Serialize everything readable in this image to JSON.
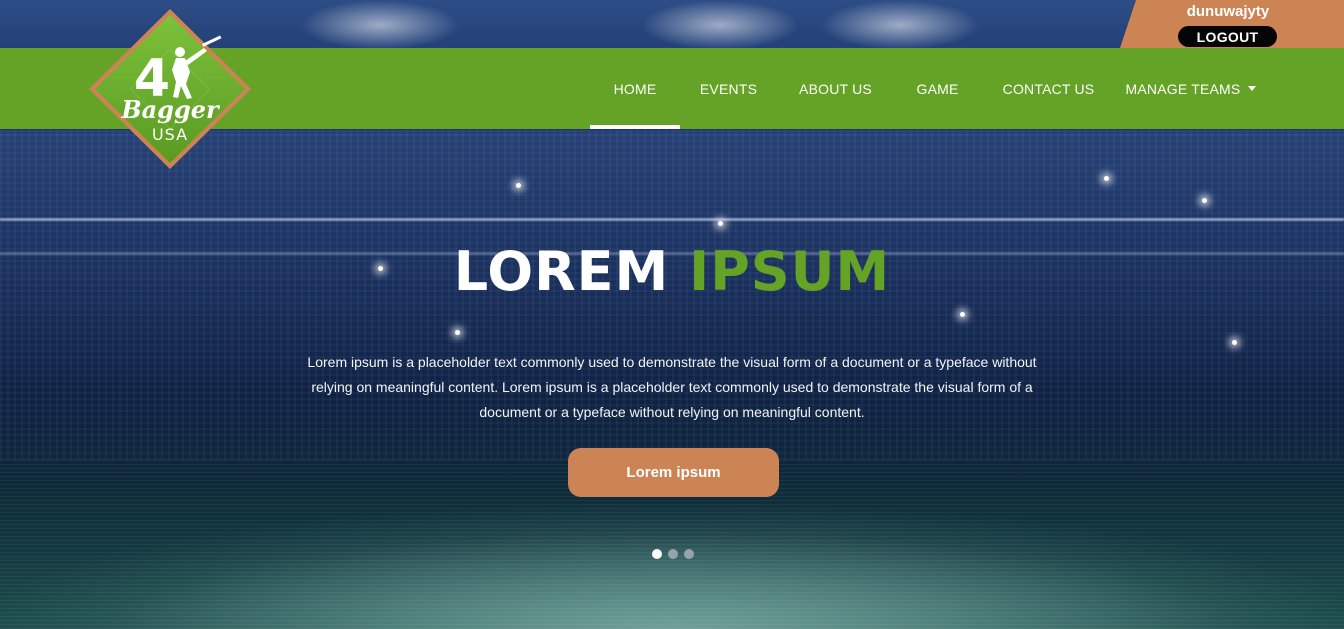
{
  "brand": {
    "logo_number": "4",
    "logo_word": "Bagger",
    "logo_sub": "USA"
  },
  "user": {
    "name": "dunuwajyty",
    "logout_label": "LOGOUT"
  },
  "nav": {
    "items": [
      {
        "label": "HOME",
        "active": true
      },
      {
        "label": "EVENTS"
      },
      {
        "label": "ABOUT US"
      },
      {
        "label": "GAME"
      },
      {
        "label": "CONTACT US"
      },
      {
        "label": "MANAGE TEAMS",
        "dropdown": true
      }
    ]
  },
  "hero": {
    "title_white": "LOREM",
    "title_accent": "IPSUM",
    "description": "Lorem ipsum is a placeholder text commonly used to demonstrate the visual form of a document or a typeface without relying on meaningful content. Lorem ipsum is a placeholder text commonly used to demonstrate the visual form of a document or a typeface without relying on meaningful content.",
    "cta_label": "Lorem ipsum"
  },
  "carousel": {
    "slide_count": 3,
    "active_index": 0
  },
  "colors": {
    "primary_green": "#65a326",
    "accent_orange": "#cc8454",
    "logout_black": "#050505"
  }
}
